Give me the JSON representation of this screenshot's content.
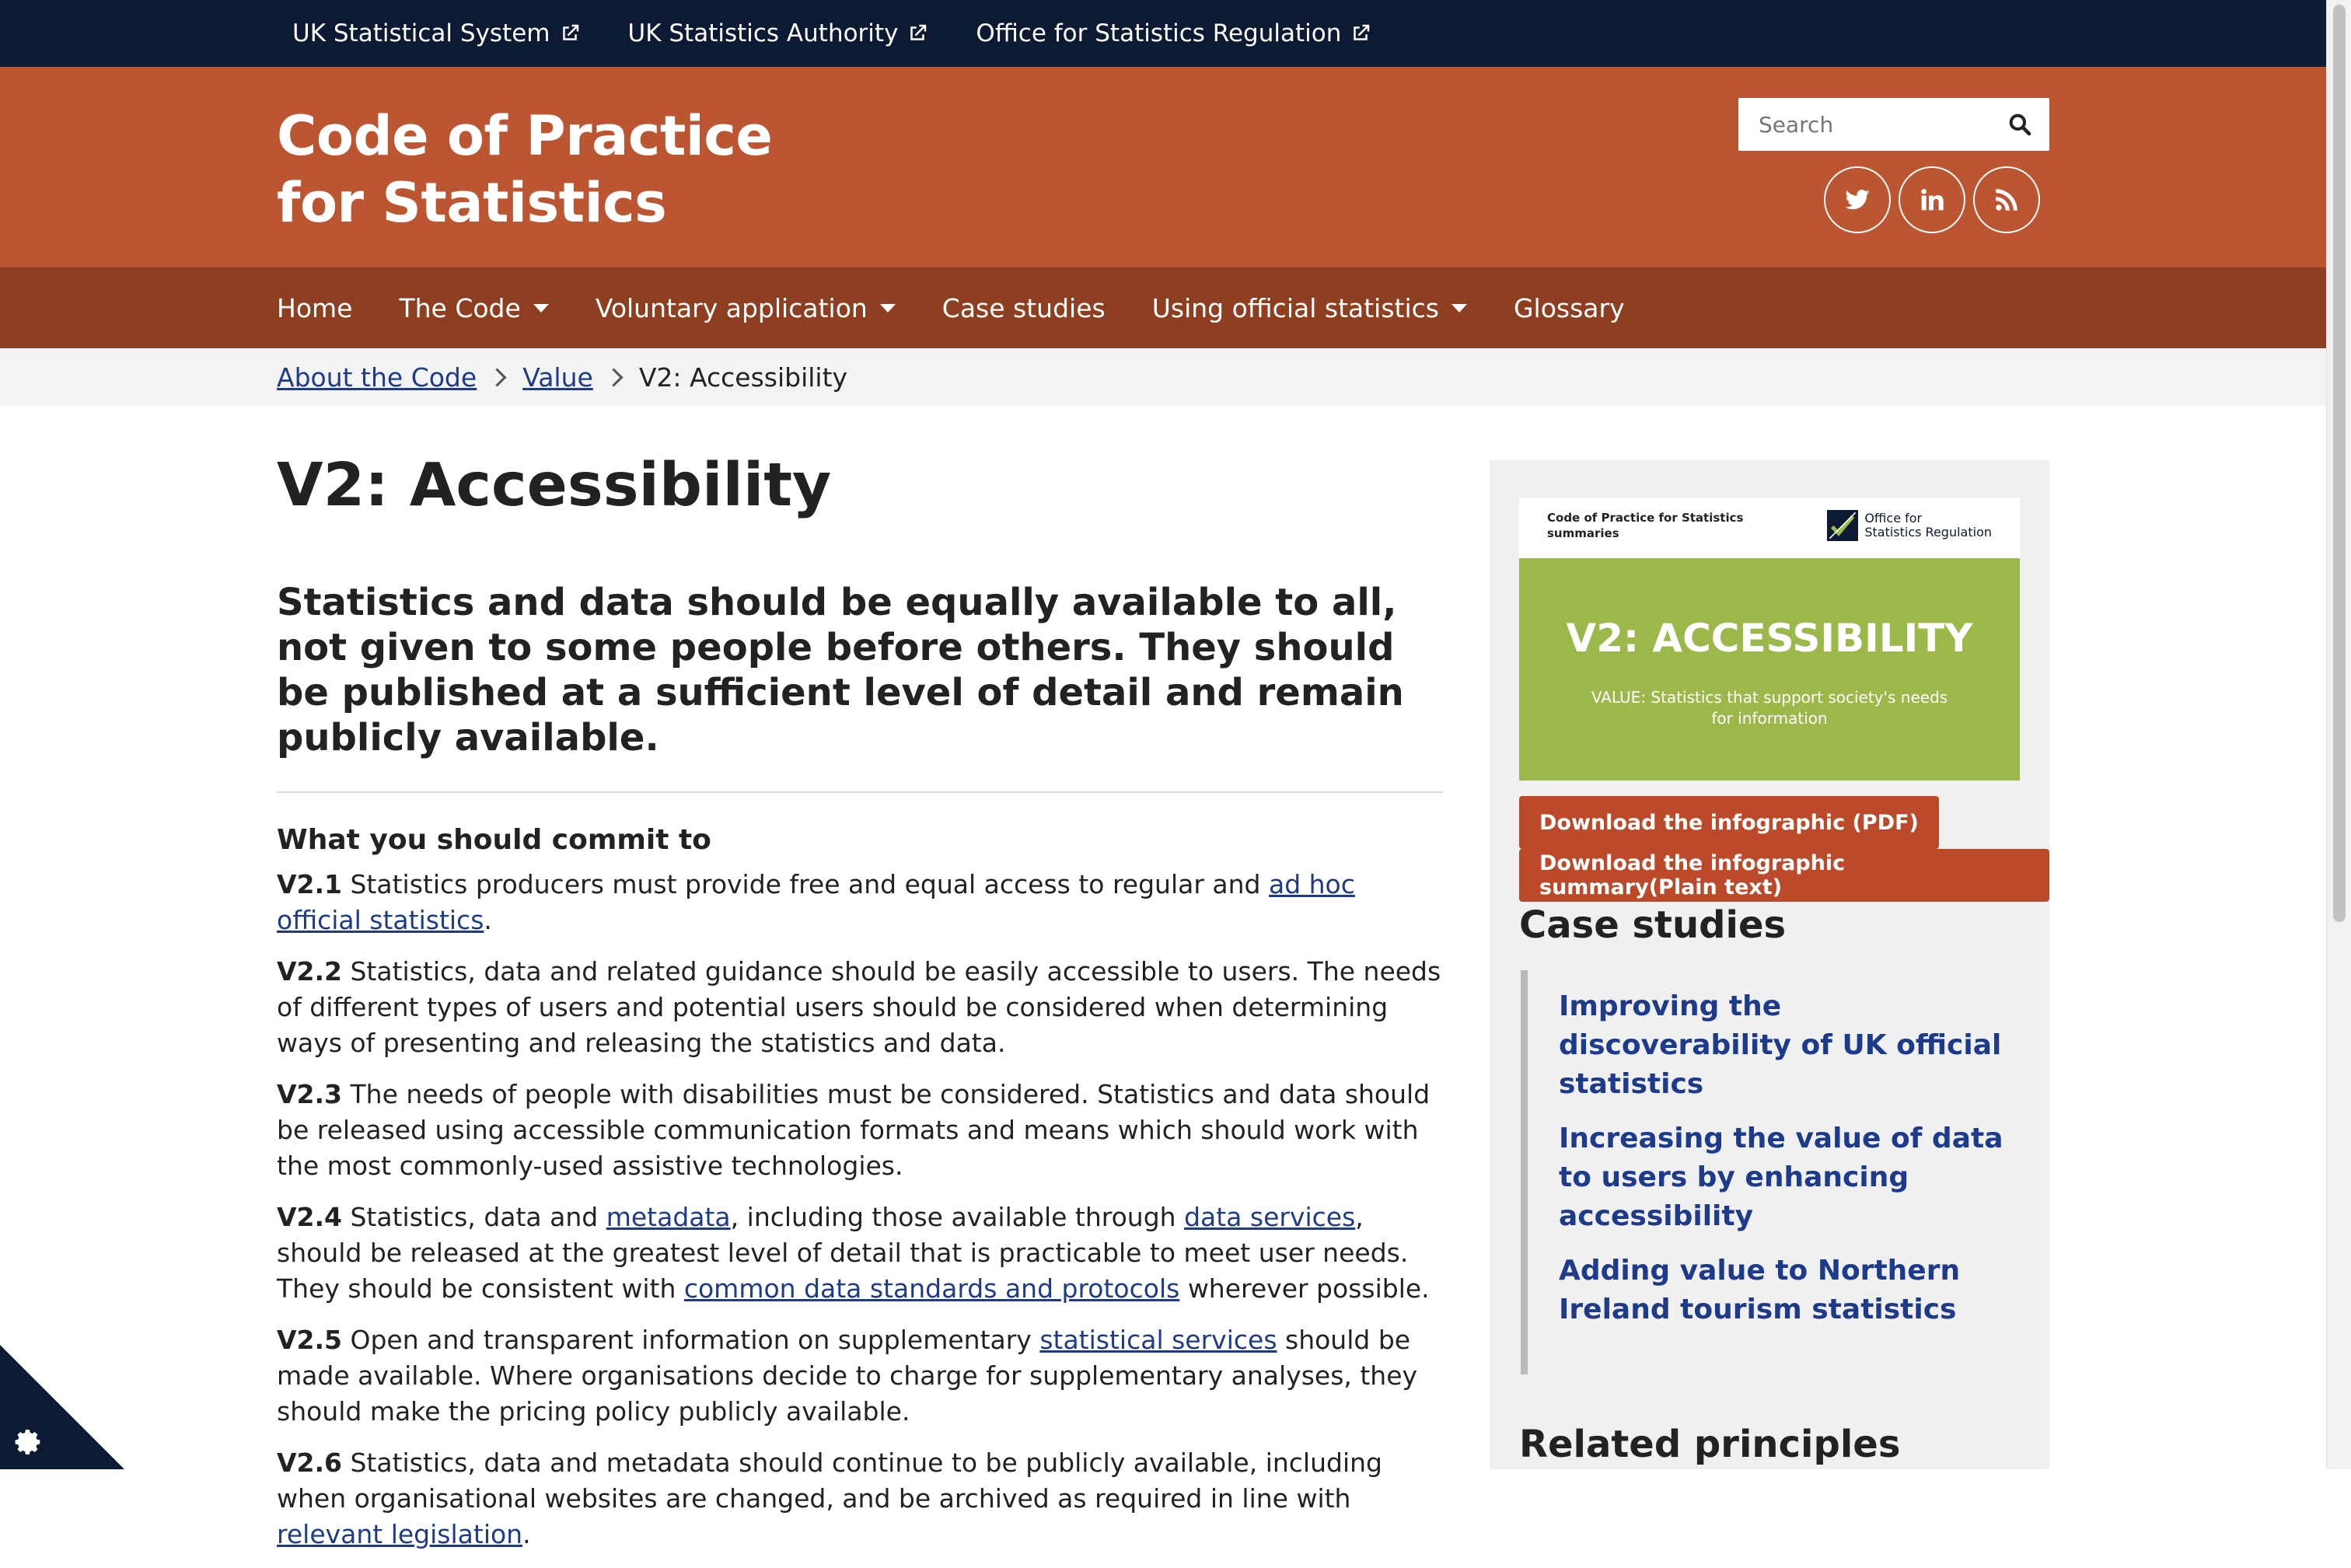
{
  "utility": {
    "links": [
      "UK Statistical System",
      "UK Statistics Authority",
      "Office for Statistics Regulation"
    ]
  },
  "header": {
    "title_line1": "Code of Practice",
    "title_line2": "for Statistics",
    "search_placeholder": "Search",
    "socials": [
      "twitter-icon",
      "linkedin-icon",
      "rss-icon"
    ],
    "colors": {
      "header_bg": "#bc5532",
      "nav_bg": "#8e3f22",
      "utility_bg": "#0c1a33"
    }
  },
  "nav": {
    "items": [
      {
        "label": "Home",
        "dropdown": false
      },
      {
        "label": "The Code",
        "dropdown": true
      },
      {
        "label": "Voluntary application",
        "dropdown": true
      },
      {
        "label": "Case studies",
        "dropdown": false
      },
      {
        "label": "Using official statistics",
        "dropdown": true
      },
      {
        "label": "Glossary",
        "dropdown": false
      }
    ]
  },
  "breadcrumb": {
    "items": [
      "About the Code",
      "Value"
    ],
    "current": "V2: Accessibility"
  },
  "main": {
    "title": "V2: Accessibility",
    "lead": "Statistics and data should be equally available to all, not given to some people before others. They should be published at a sufficient level of detail and remain publicly available.",
    "commit_heading": "What you should commit to",
    "p1": {
      "num": "V2.1",
      "text": " Statistics producers must provide free and equal access to regular and ",
      "link": "ad hoc official statistics",
      "end": "."
    },
    "p2": {
      "num": "V2.2",
      "text": " Statistics, data and related guidance should be easily accessible to users. The needs of different types of users and potential users should be considered when determining ways of presenting and releasing the statistics and data."
    },
    "p3": {
      "num": "V2.3",
      "text": " The needs of people with disabilities must be considered. Statistics and data should be released using accessible communication formats and means which should work with the most commonly-used assistive technologies."
    },
    "p4": {
      "num": "V2.4",
      "t1": " Statistics, data and ",
      "l1": "metadata",
      "t2": ", including those available through ",
      "l2": "data services",
      "t3": ", should be released at the greatest level of detail that is practicable to meet user needs. They should be consistent with ",
      "l3": "common data standards and protocols",
      "t4": " wherever possible."
    },
    "p5": {
      "num": "V2.5",
      "t1": " Open and transparent information on supplementary ",
      "l1": "statistical services",
      "t2": " should be made available. Where organisations decide to charge for supplementary analyses, they should make the pricing policy publicly available."
    },
    "p6": {
      "num": "V2.6",
      "t1": " Statistics, data and metadata should continue to be publicly available, including when organisational websites are changed, and be archived as required in line with ",
      "l1": "relevant legislation",
      "t2": "."
    }
  },
  "sidebar": {
    "card": {
      "top_left": "Code of Practice for Statistics summaries",
      "top_right_line1": "Office for",
      "top_right_line2": "Statistics Regulation",
      "title": "V2: ACCESSIBILITY",
      "subtitle": "VALUE: Statistics that support society's needs for information",
      "color": "#9cb84a"
    },
    "btn_pdf": "Download the infographic (PDF)",
    "btn_text": "Download the infographic summary(Plain text)",
    "case_studies_heading": "Case studies",
    "case_studies": [
      "Improving the discoverability of UK official statistics",
      "Increasing the value of data to users by enhancing accessibility",
      "Adding value to Northern Ireland tourism statistics"
    ],
    "related_heading": "Related principles"
  }
}
